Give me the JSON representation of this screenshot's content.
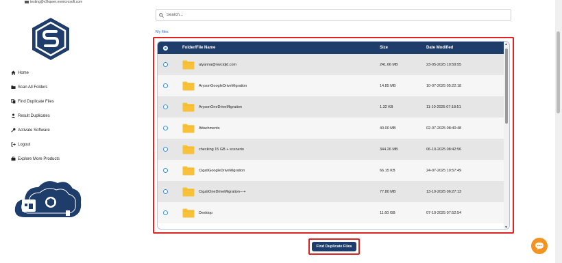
{
  "account": {
    "email": "testing@v2kqwer.onmicrosoft.com"
  },
  "sidebar": {
    "items": [
      {
        "label": "Home",
        "icon": "home-icon"
      },
      {
        "label": "Scan All Folders",
        "icon": "folder-icon"
      },
      {
        "label": "Find Duplicate Files",
        "icon": "copy-icon"
      },
      {
        "label": "Result Duplicates",
        "icon": "user-icon"
      },
      {
        "label": "Activate Software",
        "icon": "key-icon"
      },
      {
        "label": "Logout",
        "icon": "logout-icon"
      },
      {
        "label": "Explore More Products",
        "icon": "briefcase-icon"
      }
    ]
  },
  "search": {
    "placeholder": "Search..."
  },
  "main": {
    "section_label": "My files"
  },
  "table": {
    "columns": [
      "Folder/File Name",
      "Size",
      "Date Modified"
    ],
    "rows": [
      {
        "name": "alyanna@nwciqld.com",
        "size": "241.66 MB",
        "date": "23-05-2025 10:59:55"
      },
      {
        "name": "ArysonGoogleDriveMigration",
        "size": "14.85 MB",
        "date": "10-07-2025 05:22:18"
      },
      {
        "name": "ArysonOneDriveMigration",
        "size": "1.32 KB",
        "date": "11-10-2025 07:18:51"
      },
      {
        "name": "Attachments",
        "size": "40.00 MB",
        "date": "02-07-2025 08:40:48"
      },
      {
        "name": "checking 15 GB + scenerio",
        "size": "344.26 MB",
        "date": "06-10-2025 08:42:56"
      },
      {
        "name": "CigatiGoogleDriveMigration",
        "size": "66.15 KB",
        "date": "24-07-2025 10:57:49"
      },
      {
        "name": "CigatiOneDriveMigration---+",
        "size": "77.80 MB",
        "date": "13-10-2025 06:27:13"
      },
      {
        "name": "Desktop",
        "size": "11.60 GB",
        "date": "07-10-2025 07:52:54"
      }
    ]
  },
  "actions": {
    "find_duplicates_label": "Find Duplicate Files"
  },
  "colors": {
    "header": "#1f3d6b",
    "highlight": "#dd2222",
    "folder": "#f7c23a",
    "chat": "#f39322"
  }
}
